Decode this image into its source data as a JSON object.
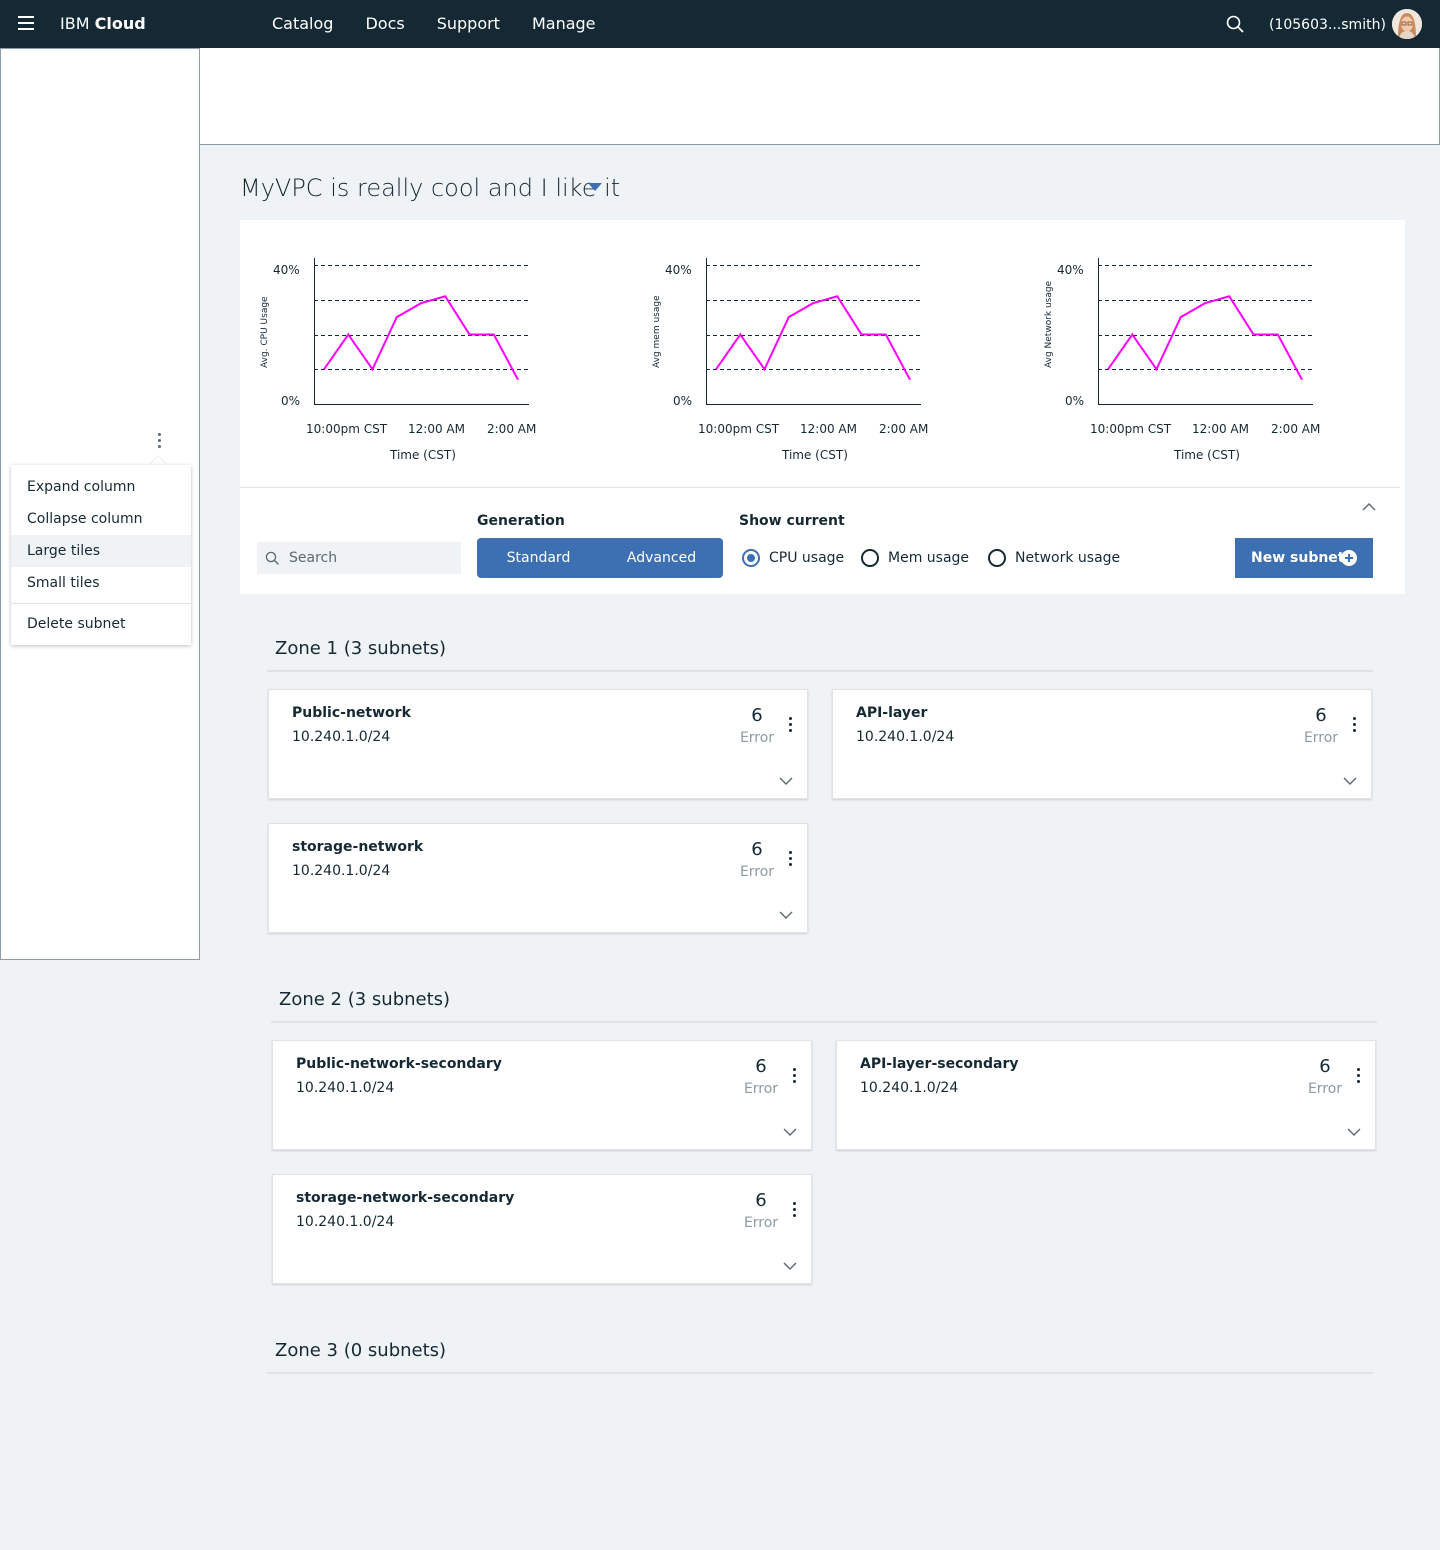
{
  "topbar": {
    "brand_regular": "IBM",
    "brand_bold": "Cloud",
    "nav": [
      "Catalog",
      "Docs",
      "Support",
      "Manage"
    ],
    "account": "(105603...smith)",
    "icons": {
      "menu": "hamburger-icon",
      "search": "search-icon",
      "avatar": "user-avatar"
    }
  },
  "menu": {
    "items": [
      "Expand column",
      "Collapse column",
      "Large tiles",
      "Small tiles"
    ],
    "delete": "Delete subnet",
    "active": "Large tiles"
  },
  "page": {
    "title": "MyVPC is really cool and I like it"
  },
  "charts": {
    "line_color": "#ff00ff",
    "x_title": "Time (CST)",
    "y_top": "40%",
    "y_bottom": "0%",
    "x_ticks": [
      "10:00pm CST",
      "12:00 AM",
      "2:00 AM"
    ]
  },
  "chart_data": [
    {
      "type": "line",
      "ylabel": "Avg. CPU Usage",
      "xlabel": "Time (CST)",
      "ylim": [
        0,
        40
      ],
      "x_ticks": [
        "10:00pm CST",
        "12:00 AM",
        "2:00 AM"
      ],
      "y_ticks": [
        "0%",
        "40%"
      ],
      "grid": "dashed horizontal",
      "x": [
        0,
        1,
        2,
        3,
        4,
        5,
        6,
        7,
        8
      ],
      "values": [
        10,
        20,
        10,
        25,
        29,
        31,
        20,
        20,
        7
      ]
    },
    {
      "type": "line",
      "ylabel": "Avg mem usage",
      "xlabel": "Time (CST)",
      "ylim": [
        0,
        40
      ],
      "x_ticks": [
        "10:00pm CST",
        "12:00 AM",
        "2:00 AM"
      ],
      "y_ticks": [
        "0%",
        "40%"
      ],
      "grid": "dashed horizontal",
      "x": [
        0,
        1,
        2,
        3,
        4,
        5,
        6,
        7,
        8
      ],
      "values": [
        10,
        20,
        10,
        25,
        29,
        31,
        20,
        20,
        7
      ]
    },
    {
      "type": "line",
      "ylabel": "Avg Network usage",
      "xlabel": "Time (CST)",
      "ylim": [
        0,
        40
      ],
      "x_ticks": [
        "10:00pm CST",
        "12:00 AM",
        "2:00 AM"
      ],
      "y_ticks": [
        "0%",
        "40%"
      ],
      "grid": "dashed horizontal",
      "x": [
        0,
        1,
        2,
        3,
        4,
        5,
        6,
        7,
        8
      ],
      "values": [
        10,
        20,
        10,
        25,
        29,
        31,
        20,
        20,
        7
      ]
    }
  ],
  "filters": {
    "search_placeholder": "Search",
    "generation_label": "Generation",
    "generation_options": [
      "Standard",
      "Advanced"
    ],
    "show_current_label": "Show current",
    "radios": [
      "CPU usage",
      "Mem usage",
      "Network usage"
    ],
    "selected_radio": "CPU usage",
    "new_subnet": "New subnet"
  },
  "zones": [
    {
      "title": "Zone 1 (3 subnets)",
      "subnets": [
        {
          "name": "Public-network",
          "cidr": "10.240.1.0/24",
          "count": "6",
          "status": "Error"
        },
        {
          "name": "API-layer",
          "cidr": "10.240.1.0/24",
          "count": "6",
          "status": "Error"
        },
        {
          "name": "storage-network",
          "cidr": "10.240.1.0/24",
          "count": "6",
          "status": "Error"
        }
      ]
    },
    {
      "title": "Zone 2 (3 subnets)",
      "subnets": [
        {
          "name": "Public-network-secondary",
          "cidr": "10.240.1.0/24",
          "count": "6",
          "status": "Error"
        },
        {
          "name": "API-layer-secondary",
          "cidr": "10.240.1.0/24",
          "count": "6",
          "status": "Error"
        },
        {
          "name": "storage-network-secondary",
          "cidr": "10.240.1.0/24",
          "count": "6",
          "status": "Error"
        }
      ]
    },
    {
      "title": "Zone 3 (0 subnets)",
      "subnets": []
    }
  ]
}
